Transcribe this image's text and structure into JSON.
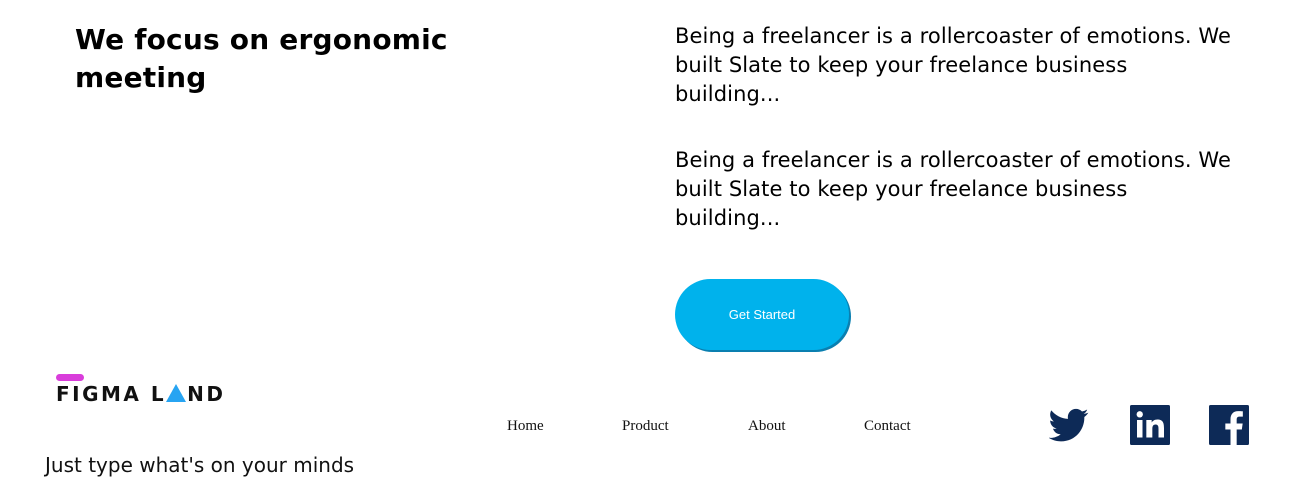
{
  "hero": {
    "heading": "We focus on ergonomic meeting",
    "paragraphs": [
      "Being a freelancer is a rollercoaster of emotions. We built Slate to keep your freelance business building...",
      "Being a freelancer is a rollercoaster of emotions. We built Slate to keep your freelance business building..."
    ],
    "cta_label": "Get Started",
    "cta_color": "#00b2ec"
  },
  "footer": {
    "logo": {
      "text_before": "FIGMA L",
      "text_after": "ND",
      "bar_color": "#d93ddb",
      "triangle_color": "#27a4f2"
    },
    "tagline": "Just type what's on your minds",
    "nav": [
      {
        "label": "Home"
      },
      {
        "label": "Product"
      },
      {
        "label": "About"
      },
      {
        "label": "Contact"
      }
    ],
    "social": [
      {
        "icon": "twitter-icon"
      },
      {
        "icon": "linkedin-icon"
      },
      {
        "icon": "facebook-icon"
      }
    ],
    "social_color": "#0d2a57"
  }
}
